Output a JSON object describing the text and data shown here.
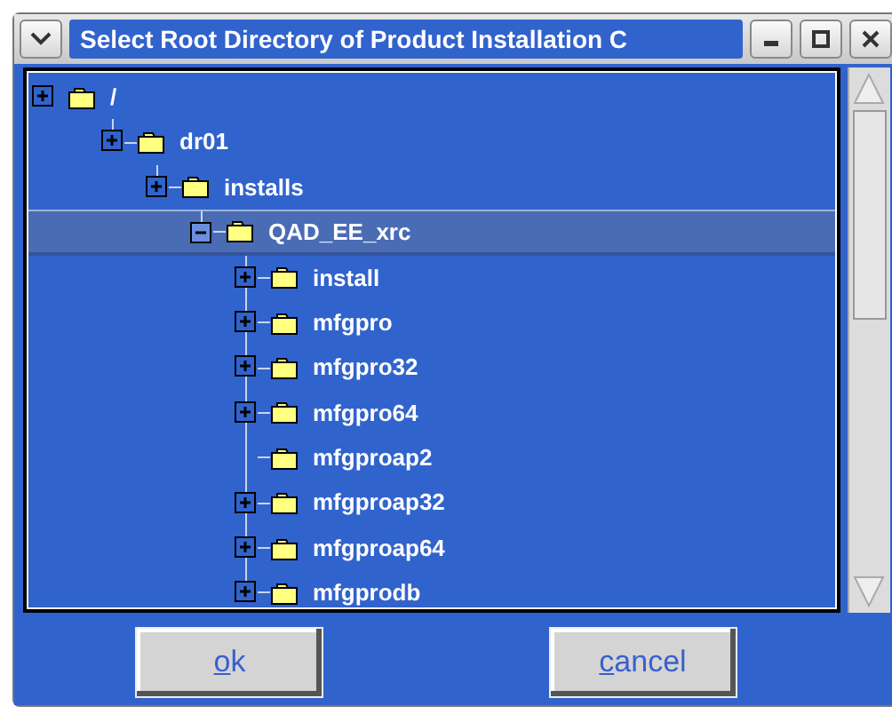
{
  "window": {
    "title": "Select Root Directory of Product Installation C"
  },
  "tree": [
    {
      "label": "/",
      "expandable": true,
      "expanded": false,
      "selected": false,
      "children": [
        {
          "label": "dr01",
          "expandable": true,
          "expanded": false,
          "selected": false,
          "children": [
            {
              "label": "installs",
              "expandable": true,
              "expanded": false,
              "selected": false,
              "children": [
                {
                  "label": "QAD_EE_xrc",
                  "expandable": true,
                  "expanded": true,
                  "selected": true,
                  "children": [
                    {
                      "label": "install",
                      "expandable": true,
                      "expanded": false,
                      "selected": false
                    },
                    {
                      "label": "mfgpro",
                      "expandable": true,
                      "expanded": false,
                      "selected": false
                    },
                    {
                      "label": "mfgpro32",
                      "expandable": true,
                      "expanded": false,
                      "selected": false
                    },
                    {
                      "label": "mfgpro64",
                      "expandable": true,
                      "expanded": false,
                      "selected": false
                    },
                    {
                      "label": "mfgproap2",
                      "expandable": false,
                      "selected": false
                    },
                    {
                      "label": "mfgproap32",
                      "expandable": true,
                      "expanded": false,
                      "selected": false
                    },
                    {
                      "label": "mfgproap64",
                      "expandable": true,
                      "expanded": false,
                      "selected": false
                    },
                    {
                      "label": "mfgprodb",
                      "expandable": true,
                      "expanded": false,
                      "selected": false
                    }
                  ]
                }
              ]
            }
          ]
        }
      ]
    }
  ],
  "buttons": [
    {
      "label": "ok",
      "underline_first": true
    },
    {
      "label": "cancel",
      "underline_first": true
    }
  ]
}
